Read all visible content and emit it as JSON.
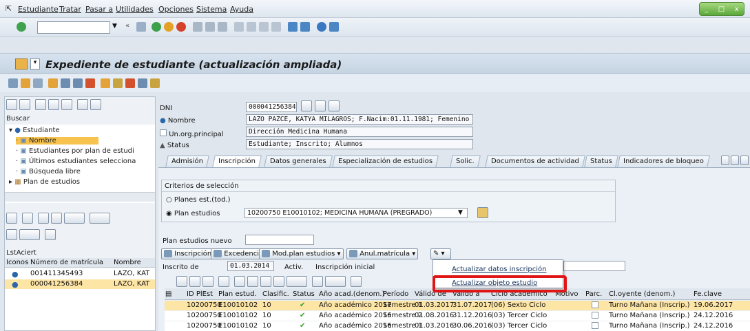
{
  "menu": {
    "items": [
      "Estudiante",
      "Tratar",
      "Pasar a",
      "Utilidades",
      "Opciones",
      "Sistema",
      "Ayuda"
    ],
    "window_buttons": [
      "_",
      "□",
      "x"
    ]
  },
  "header": {
    "title": "Expediente de estudiante (actualización ampliada)"
  },
  "left": {
    "buscar": "Buscar",
    "tree": [
      {
        "label": "Estudiante",
        "level": 0
      },
      {
        "label": "Nombre",
        "level": 1,
        "selected": true
      },
      {
        "label": "Estudiantes por plan de estudi",
        "level": 1
      },
      {
        "label": "Últimos estudiantes selecciona",
        "level": 1
      },
      {
        "label": "Búsqueda libre",
        "level": 1
      },
      {
        "label": "Plan de estudios",
        "level": 0
      }
    ],
    "lst_label": "LstAciert",
    "list_headers": [
      "Iconos",
      "Número de matrícula",
      "Nombre"
    ],
    "list_rows": [
      {
        "matricula": "001411345493",
        "nombre": "LAZO, KAT"
      },
      {
        "matricula": "000041256384",
        "nombre": "LAZO, KAT"
      }
    ]
  },
  "student": {
    "dni_label": "DNI",
    "dni": "000041256384",
    "nombre_label": "Nombre",
    "nombre": "LAZO PAZCE, KATYA MILAGROS; F.Nacim:01.11.1981; Femenino",
    "unorg_label": "Un.org.principal",
    "unorg": "Dirección Medicina Humana",
    "status_label": "Status",
    "status": "Estudiante; Inscrito; Alumnos"
  },
  "tabs": [
    "Admisión",
    "Inscripción",
    "Datos generales",
    "Especialización de estudios",
    "Solic.",
    "Documentos de actividad",
    "Status",
    "Indicadores de bloqueo"
  ],
  "criterios": {
    "title": "Criterios de selección",
    "opt1": "Planes est.(tod.)",
    "opt2": "Plan estudios",
    "plan_value": "10200750 E10010102; MEDICINA HUMANA (PREGRADO)"
  },
  "plan_nuevo_label": "Plan estudios nuevo",
  "actions": {
    "inscripcion": "Inscripción",
    "excedencia": "Excedencia",
    "modplan": "Mod.plan estudios",
    "anul": "Anul.matrícula"
  },
  "inscrito": {
    "label": "Inscrito de",
    "date": "01.03.2014",
    "activ_label": "Activ.",
    "activ_value": "Inscripción inicial"
  },
  "context_menu": {
    "item1": "Actualizar datos inscripción",
    "item2": "Actualizar objeto estudio"
  },
  "grid": {
    "headers": [
      "ID PlEst",
      "Plan estud.",
      "Clasific.",
      "Status",
      "Año acad.(denom.)",
      "Período",
      "Válido de",
      "Válido a",
      "Ciclo académico",
      "Motivo",
      "Parc.",
      "Cl.oyente (denom.)",
      "Fe.clave"
    ],
    "rows": [
      {
        "id": "10200750",
        "plan": "E10010102",
        "clas": "10",
        "anio": "Año académico 2017",
        "per": "Semestre 1",
        "de": "01.03.2017",
        "a": "31.07.2017",
        "ciclo": "(06) Sexto Ciclo",
        "oy": "Turno Mañana (Inscrip.)",
        "fe": "19.06.2017"
      },
      {
        "id": "10200750",
        "plan": "E10010102",
        "clas": "10",
        "anio": "Año académico 2016",
        "per": "Semestre 2",
        "de": "01.08.2016",
        "a": "31.12.2016",
        "ciclo": "(03) Tercer Ciclo",
        "oy": "Turno Mañana (Inscrip.)",
        "fe": "24.12.2016"
      },
      {
        "id": "10200750",
        "plan": "E10010102",
        "clas": "10",
        "anio": "Año académico 2016",
        "per": "Semestre 1",
        "de": "01.03.2016",
        "a": "30.06.2016",
        "ciclo": "(03) Tercer Ciclo",
        "oy": "Turno Mañana (Inscrip.)",
        "fe": "24.12.2016"
      }
    ]
  },
  "colors": {
    "accent_red": "#e01616",
    "selection": "#f7c24d"
  }
}
